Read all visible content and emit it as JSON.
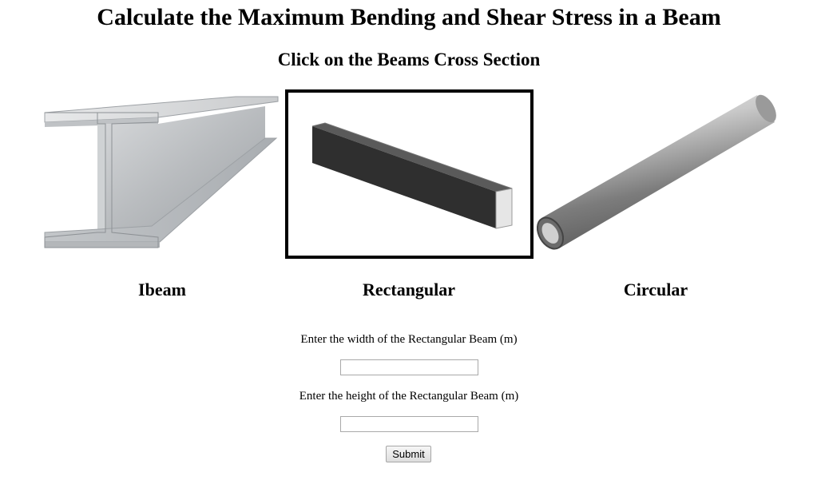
{
  "page": {
    "title": "Calculate the Maximum Bending and Shear Stress in a Beam",
    "subtitle": "Click on the Beams Cross Section"
  },
  "beams": [
    {
      "label": "Ibeam",
      "image": "i-beam-image",
      "selected": false
    },
    {
      "label": "Rectangular",
      "image": "rectangular-beam-image",
      "selected": true
    },
    {
      "label": "Circular",
      "image": "circular-tube-image",
      "selected": false
    }
  ],
  "form": {
    "width_label": "Enter the width of the Rectangular Beam (m)",
    "width_value": "",
    "height_label": "Enter the height of the Rectangular Beam (m)",
    "height_value": "",
    "submit_label": "Submit"
  },
  "colors": {
    "selection_border": "#000000",
    "background": "#ffffff"
  }
}
